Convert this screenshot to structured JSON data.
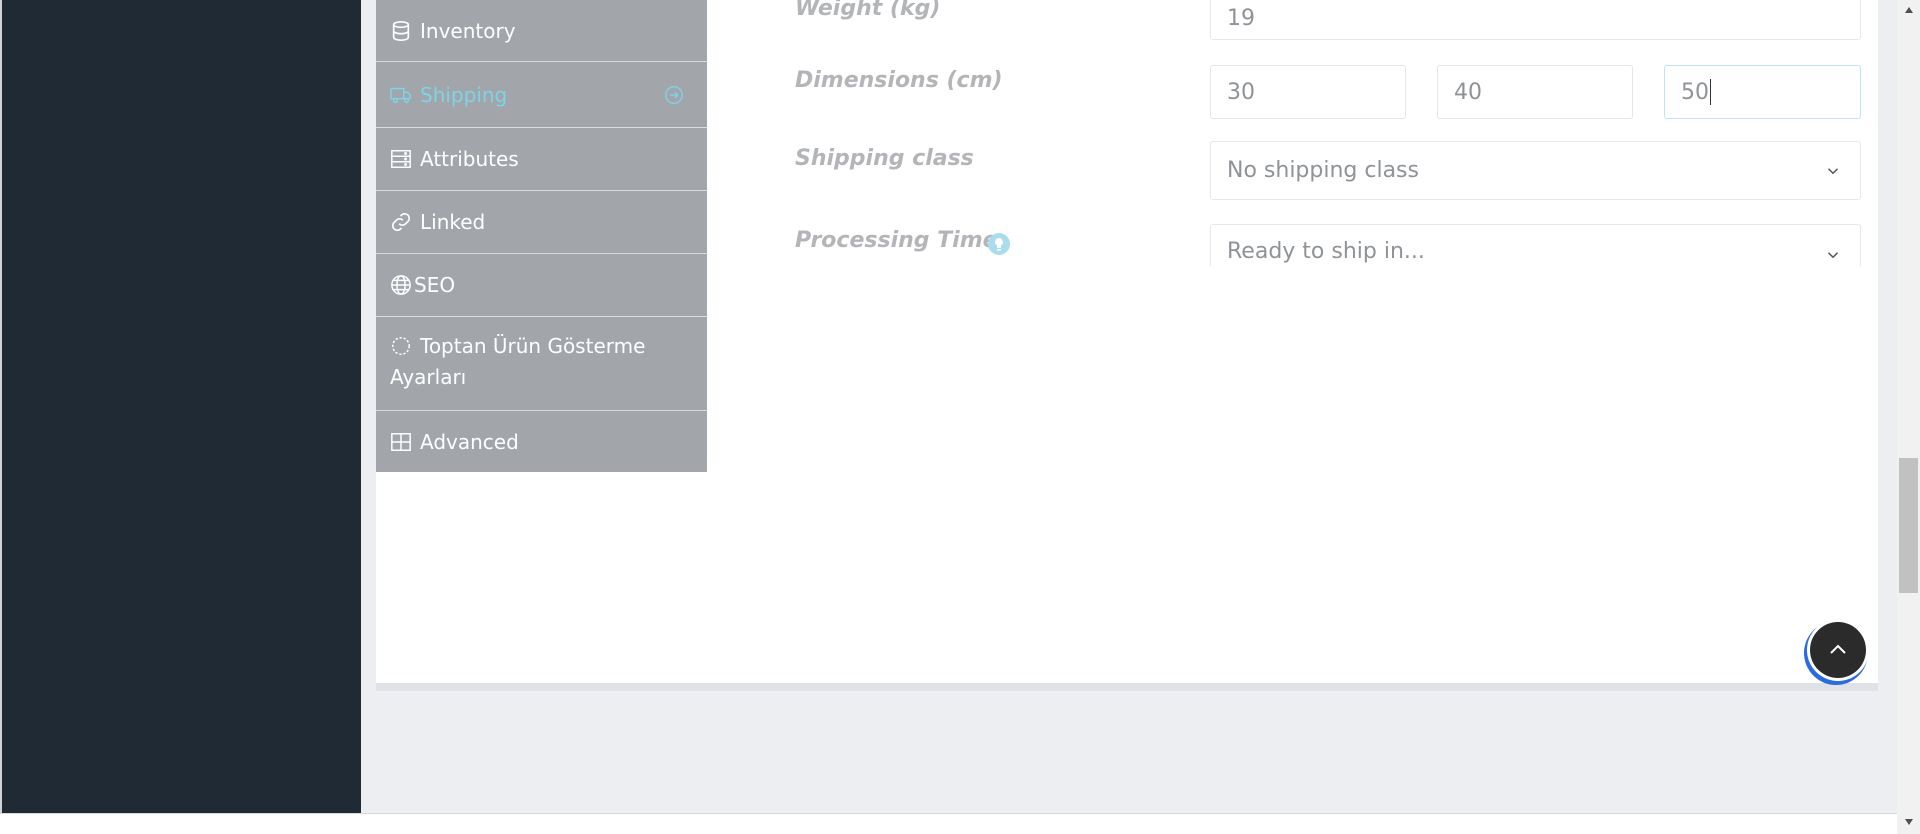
{
  "tabs": [
    {
      "label": "Inventory",
      "icon": "database-icon"
    },
    {
      "label": "Shipping",
      "icon": "truck-icon",
      "active": true
    },
    {
      "label": "Attributes",
      "icon": "server-icon"
    },
    {
      "label": "Linked",
      "icon": "link-icon"
    },
    {
      "label": "SEO",
      "icon": "globe-icon"
    },
    {
      "label": "Toptan Ürün Gösterme Ayarları",
      "icon": "loader-icon"
    },
    {
      "label": "Advanced",
      "icon": "grid-icon"
    }
  ],
  "shipping": {
    "weight_label": "Weight (kg)",
    "weight_value": "19",
    "dimensions_label": "Dimensions (cm)",
    "length": "30",
    "width": "40",
    "height": "50",
    "class_label": "Shipping class",
    "class_value": "No shipping class",
    "processing_label": "Processing Time",
    "processing_value": "Ready to ship in..."
  },
  "colors": {
    "sidebar_dark": "#1f2a35",
    "tab_bg": "#a2a6ab",
    "tab_active_text": "#7ed3e6",
    "label_text": "#b3b5b8"
  }
}
